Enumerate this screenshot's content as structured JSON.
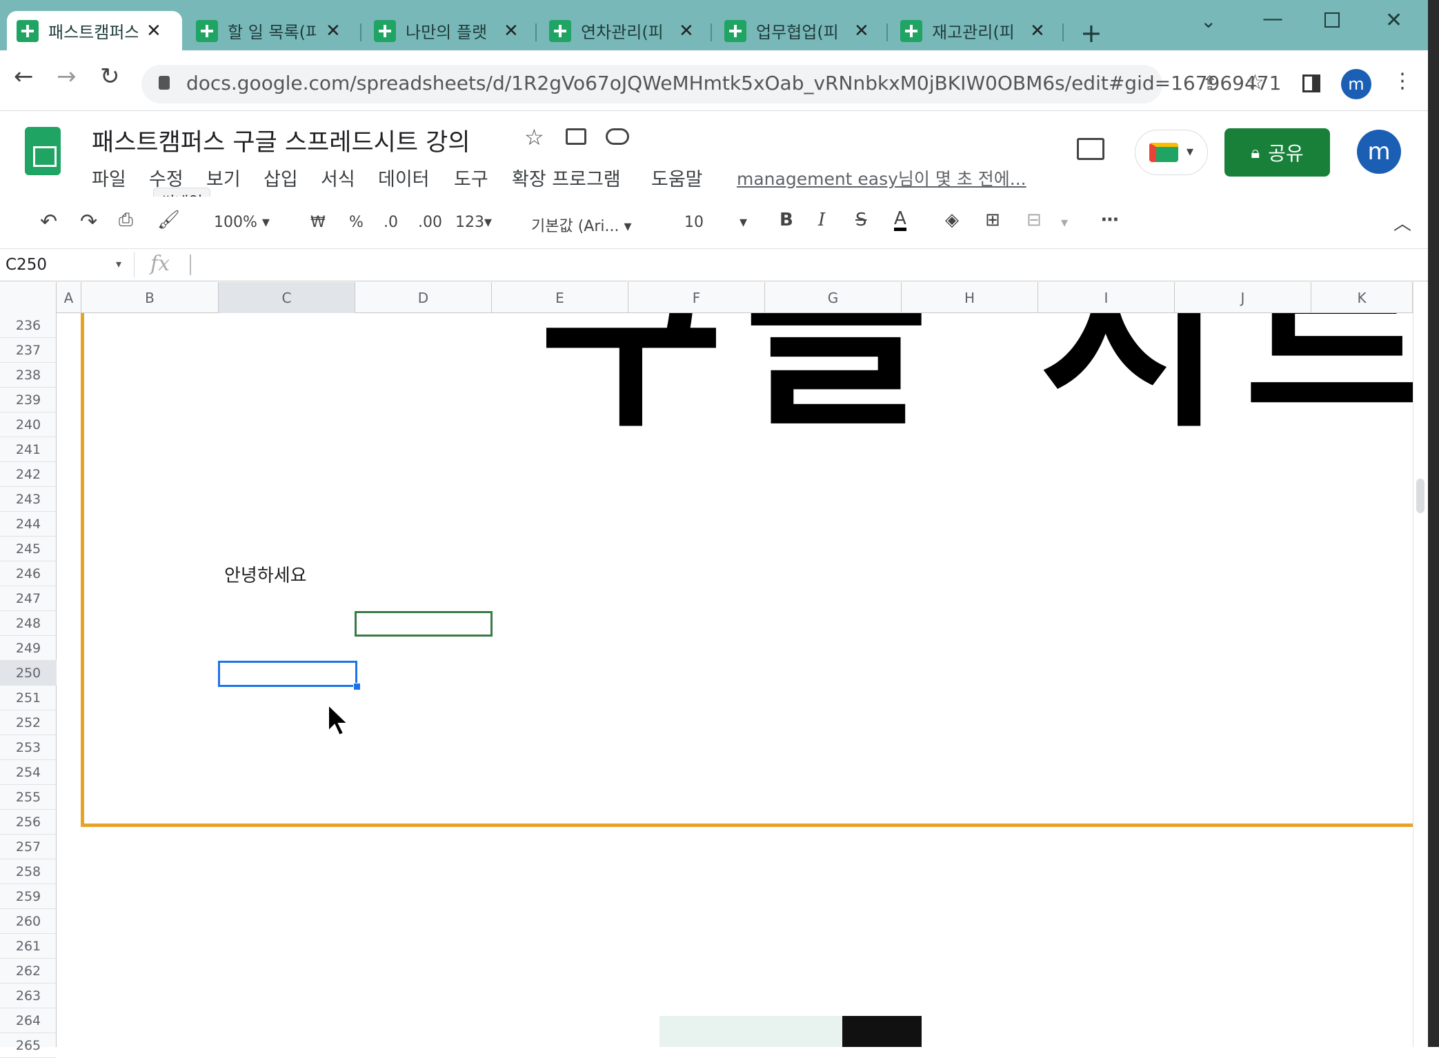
{
  "browser": {
    "tabs": [
      {
        "title": "패스트캠퍼스"
      },
      {
        "title": "할 일 목록(피"
      },
      {
        "title": "나만의 플랫"
      },
      {
        "title": "연차관리(피"
      },
      {
        "title": "업무협업(피"
      },
      {
        "title": "재고관리(피"
      }
    ],
    "url": "docs.google.com/spreadsheets/d/1R2gVo67oJQWeMHmtk5xOab_vRNnbkxM0jBKIW0OBM6s/edit#gid=167969471"
  },
  "sheet": {
    "title": "패스트캠퍼스 구글 스프레드시트 강의",
    "menus": [
      "파일",
      "수정",
      "보기",
      "삽입",
      "서식",
      "데이터",
      "도구",
      "확장 프로그램",
      "도움말"
    ],
    "last_edit": "management easy님이 몇 초 전에...",
    "tooltip": "썸네일",
    "share_label": "공유",
    "avatar_letter": "m"
  },
  "toolbar": {
    "zoom": "100%",
    "currency": "₩",
    "percent": "%",
    "dec_decrease": ".0",
    "dec_increase": ".00",
    "number_format": "123",
    "font": "기본값 (Ari...",
    "font_size": "10"
  },
  "formula_bar": {
    "cell_ref": "C250",
    "fx": "fx",
    "value": ""
  },
  "grid": {
    "columns": [
      "A",
      "B",
      "C",
      "D",
      "E",
      "F",
      "G",
      "H",
      "I",
      "J",
      "K"
    ],
    "rows": [
      "236",
      "237",
      "238",
      "239",
      "240",
      "241",
      "242",
      "243",
      "244",
      "245",
      "246",
      "247",
      "248",
      "249",
      "250",
      "251",
      "252",
      "253",
      "254",
      "255",
      "256",
      "257",
      "258",
      "259",
      "260",
      "261",
      "262",
      "263",
      "264",
      "265"
    ],
    "big_text": "구글 시트 이",
    "cell_b246": "안녕하세요",
    "selected_cell": "C250"
  },
  "colors": {
    "tab_strip": "#79b8b8",
    "sheets_green": "#1fa463",
    "share_green": "#188038",
    "selection_blue": "#1a73e8",
    "border_orange": "#e6a327"
  }
}
